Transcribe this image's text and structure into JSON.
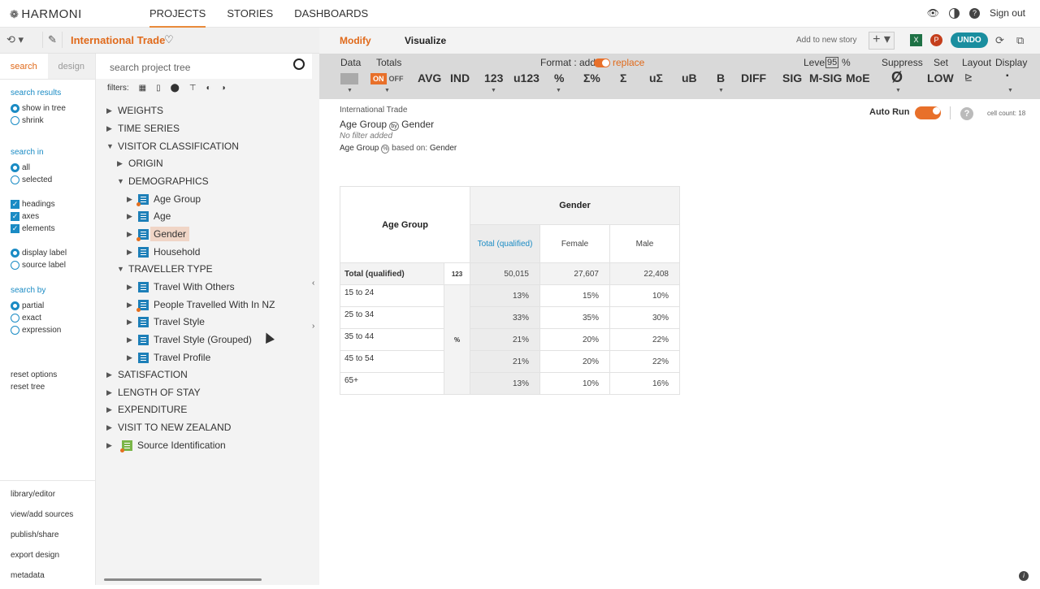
{
  "brand": "HARMONI",
  "nav": [
    "PROJECTS",
    "STORIES",
    "DASHBOARDS"
  ],
  "sign_out": "Sign out",
  "project_title": "International Trade",
  "side_tabs": [
    "search",
    "design"
  ],
  "search_placeholder": "search project tree",
  "filters_label": "filters:",
  "side": {
    "search_results_title": "search results",
    "search_results": [
      "show in tree",
      "shrink"
    ],
    "search_in_title": "search in",
    "search_in": [
      "all",
      "selected"
    ],
    "checks": [
      "headings",
      "axes",
      "elements"
    ],
    "labels": [
      "display label",
      "source label"
    ],
    "search_by_title": "search by",
    "search_by": [
      "partial",
      "exact",
      "expression"
    ],
    "reset": [
      "reset options",
      "reset tree"
    ],
    "bottom": [
      "library/editor",
      "view/add sources",
      "publish/share",
      "export design",
      "metadata"
    ]
  },
  "tree": [
    "WEIGHTS",
    "TIME SERIES",
    "VISITOR CLASSIFICATION",
    "ORIGIN",
    "DEMOGRAPHICS",
    "Age Group",
    "Age",
    "Gender",
    "Household",
    "TRAVELLER TYPE",
    "Travel With Others",
    "People Travelled With In NZ",
    "Travel Style",
    "Travel Style (Grouped)",
    "Travel Profile",
    "SATISFACTION",
    "LENGTH OF STAY",
    "EXPENDITURE",
    "VISIT TO NEW ZEALAND",
    "Source Identification"
  ],
  "rtabs": [
    "Modify",
    "Visualize"
  ],
  "add_story": "Add to new story",
  "undo": "UNDO",
  "toolbar": {
    "data": "Data",
    "totals": "Totals",
    "on": "ON",
    "off": "OFF",
    "format": "Format : add",
    "replace": "replace",
    "level": "Level",
    "level_val": "95",
    "pct": "%",
    "suppress": "Suppress",
    "set": "Set",
    "layout": "Layout",
    "display": "Display",
    "buttons": [
      "AVG",
      "IND",
      "123",
      "u123",
      "%",
      "Σ%",
      "Σ",
      "uΣ",
      "uB",
      "B",
      "DIFF",
      "SIG",
      "M-SIG",
      "MoE",
      "Ø",
      "LOW"
    ]
  },
  "meta": {
    "line1": "International Trade",
    "row_var": "Age Group",
    "col_var": "Gender",
    "by": "by",
    "no_filter": "No filter added",
    "pct_var": "Age Group",
    "based_on": "based on:",
    "based_var": "Gender"
  },
  "auto_run": "Auto Run",
  "cell_count": "cell count: 18",
  "table": {
    "corner": "Age Group",
    "col_header": "Gender",
    "cols": [
      "Total (qualified)",
      "Female",
      "Male"
    ],
    "total_label": "Total (qualified)",
    "total_mark": "123",
    "total_vals": [
      "50,015",
      "27,607",
      "22,408"
    ],
    "pct_mark": "%",
    "rows": [
      {
        "label": "15 to 24",
        "vals": [
          "13%",
          "15%",
          "10%"
        ]
      },
      {
        "label": "25 to 34",
        "vals": [
          "33%",
          "35%",
          "30%"
        ]
      },
      {
        "label": "35 to 44",
        "vals": [
          "21%",
          "20%",
          "22%"
        ]
      },
      {
        "label": "45 to 54",
        "vals": [
          "21%",
          "20%",
          "22%"
        ]
      },
      {
        "label": "65+",
        "vals": [
          "13%",
          "10%",
          "16%"
        ]
      }
    ]
  }
}
